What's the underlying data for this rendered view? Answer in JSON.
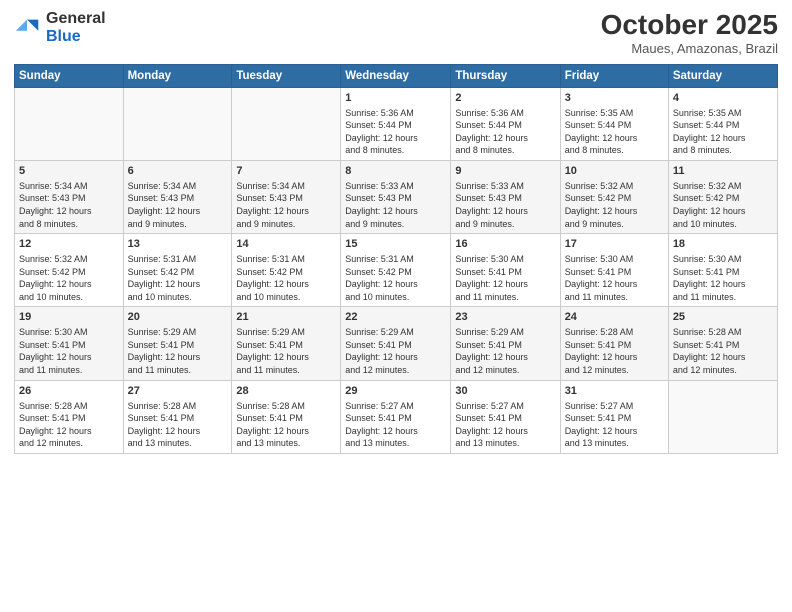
{
  "header": {
    "logo_general": "General",
    "logo_blue": "Blue",
    "month_title": "October 2025",
    "subtitle": "Maues, Amazonas, Brazil"
  },
  "days_of_week": [
    "Sunday",
    "Monday",
    "Tuesday",
    "Wednesday",
    "Thursday",
    "Friday",
    "Saturday"
  ],
  "weeks": [
    {
      "days": [
        {
          "num": "",
          "info": ""
        },
        {
          "num": "",
          "info": ""
        },
        {
          "num": "",
          "info": ""
        },
        {
          "num": "1",
          "info": "Sunrise: 5:36 AM\nSunset: 5:44 PM\nDaylight: 12 hours\nand 8 minutes."
        },
        {
          "num": "2",
          "info": "Sunrise: 5:36 AM\nSunset: 5:44 PM\nDaylight: 12 hours\nand 8 minutes."
        },
        {
          "num": "3",
          "info": "Sunrise: 5:35 AM\nSunset: 5:44 PM\nDaylight: 12 hours\nand 8 minutes."
        },
        {
          "num": "4",
          "info": "Sunrise: 5:35 AM\nSunset: 5:44 PM\nDaylight: 12 hours\nand 8 minutes."
        }
      ]
    },
    {
      "days": [
        {
          "num": "5",
          "info": "Sunrise: 5:34 AM\nSunset: 5:43 PM\nDaylight: 12 hours\nand 8 minutes."
        },
        {
          "num": "6",
          "info": "Sunrise: 5:34 AM\nSunset: 5:43 PM\nDaylight: 12 hours\nand 9 minutes."
        },
        {
          "num": "7",
          "info": "Sunrise: 5:34 AM\nSunset: 5:43 PM\nDaylight: 12 hours\nand 9 minutes."
        },
        {
          "num": "8",
          "info": "Sunrise: 5:33 AM\nSunset: 5:43 PM\nDaylight: 12 hours\nand 9 minutes."
        },
        {
          "num": "9",
          "info": "Sunrise: 5:33 AM\nSunset: 5:43 PM\nDaylight: 12 hours\nand 9 minutes."
        },
        {
          "num": "10",
          "info": "Sunrise: 5:32 AM\nSunset: 5:42 PM\nDaylight: 12 hours\nand 9 minutes."
        },
        {
          "num": "11",
          "info": "Sunrise: 5:32 AM\nSunset: 5:42 PM\nDaylight: 12 hours\nand 10 minutes."
        }
      ]
    },
    {
      "days": [
        {
          "num": "12",
          "info": "Sunrise: 5:32 AM\nSunset: 5:42 PM\nDaylight: 12 hours\nand 10 minutes."
        },
        {
          "num": "13",
          "info": "Sunrise: 5:31 AM\nSunset: 5:42 PM\nDaylight: 12 hours\nand 10 minutes."
        },
        {
          "num": "14",
          "info": "Sunrise: 5:31 AM\nSunset: 5:42 PM\nDaylight: 12 hours\nand 10 minutes."
        },
        {
          "num": "15",
          "info": "Sunrise: 5:31 AM\nSunset: 5:42 PM\nDaylight: 12 hours\nand 10 minutes."
        },
        {
          "num": "16",
          "info": "Sunrise: 5:30 AM\nSunset: 5:41 PM\nDaylight: 12 hours\nand 11 minutes."
        },
        {
          "num": "17",
          "info": "Sunrise: 5:30 AM\nSunset: 5:41 PM\nDaylight: 12 hours\nand 11 minutes."
        },
        {
          "num": "18",
          "info": "Sunrise: 5:30 AM\nSunset: 5:41 PM\nDaylight: 12 hours\nand 11 minutes."
        }
      ]
    },
    {
      "days": [
        {
          "num": "19",
          "info": "Sunrise: 5:30 AM\nSunset: 5:41 PM\nDaylight: 12 hours\nand 11 minutes."
        },
        {
          "num": "20",
          "info": "Sunrise: 5:29 AM\nSunset: 5:41 PM\nDaylight: 12 hours\nand 11 minutes."
        },
        {
          "num": "21",
          "info": "Sunrise: 5:29 AM\nSunset: 5:41 PM\nDaylight: 12 hours\nand 11 minutes."
        },
        {
          "num": "22",
          "info": "Sunrise: 5:29 AM\nSunset: 5:41 PM\nDaylight: 12 hours\nand 12 minutes."
        },
        {
          "num": "23",
          "info": "Sunrise: 5:29 AM\nSunset: 5:41 PM\nDaylight: 12 hours\nand 12 minutes."
        },
        {
          "num": "24",
          "info": "Sunrise: 5:28 AM\nSunset: 5:41 PM\nDaylight: 12 hours\nand 12 minutes."
        },
        {
          "num": "25",
          "info": "Sunrise: 5:28 AM\nSunset: 5:41 PM\nDaylight: 12 hours\nand 12 minutes."
        }
      ]
    },
    {
      "days": [
        {
          "num": "26",
          "info": "Sunrise: 5:28 AM\nSunset: 5:41 PM\nDaylight: 12 hours\nand 12 minutes."
        },
        {
          "num": "27",
          "info": "Sunrise: 5:28 AM\nSunset: 5:41 PM\nDaylight: 12 hours\nand 13 minutes."
        },
        {
          "num": "28",
          "info": "Sunrise: 5:28 AM\nSunset: 5:41 PM\nDaylight: 12 hours\nand 13 minutes."
        },
        {
          "num": "29",
          "info": "Sunrise: 5:27 AM\nSunset: 5:41 PM\nDaylight: 12 hours\nand 13 minutes."
        },
        {
          "num": "30",
          "info": "Sunrise: 5:27 AM\nSunset: 5:41 PM\nDaylight: 12 hours\nand 13 minutes."
        },
        {
          "num": "31",
          "info": "Sunrise: 5:27 AM\nSunset: 5:41 PM\nDaylight: 12 hours\nand 13 minutes."
        },
        {
          "num": "",
          "info": ""
        }
      ]
    }
  ]
}
